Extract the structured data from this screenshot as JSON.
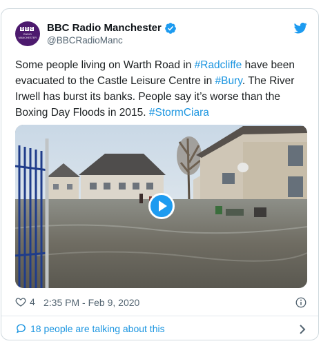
{
  "account": {
    "display_name": "BBC Radio Manchester",
    "handle": "@BBCRadioManc",
    "avatar_letters": [
      "B",
      "B",
      "C"
    ],
    "avatar_sub": "RADIO MANCHESTER",
    "verified": true
  },
  "tweet": {
    "segments": [
      {
        "text": "Some people living on Warth Road in ",
        "type": "text"
      },
      {
        "text": "#Radcliffe",
        "type": "link"
      },
      {
        "text": " have been evacuated to the Castle Leisure Centre in ",
        "type": "text"
      },
      {
        "text": "#Bury",
        "type": "link"
      },
      {
        "text": ". The River Irwell has burst its banks. People say it’s worse than the Boxing Day Floods in 2015. ",
        "type": "text"
      },
      {
        "text": "#StormCiara",
        "type": "link"
      }
    ]
  },
  "media": {
    "kind": "video",
    "icon": "play-icon"
  },
  "meta": {
    "likes": "4",
    "timestamp": "2:35 PM - Feb 9, 2020"
  },
  "conversation": {
    "label": "18 people are talking about this"
  },
  "colors": {
    "link": "#1b95e0",
    "brand_blue": "#1d9bf0",
    "avatar_bg": "#4d1a6e",
    "border": "#cfd9de"
  }
}
